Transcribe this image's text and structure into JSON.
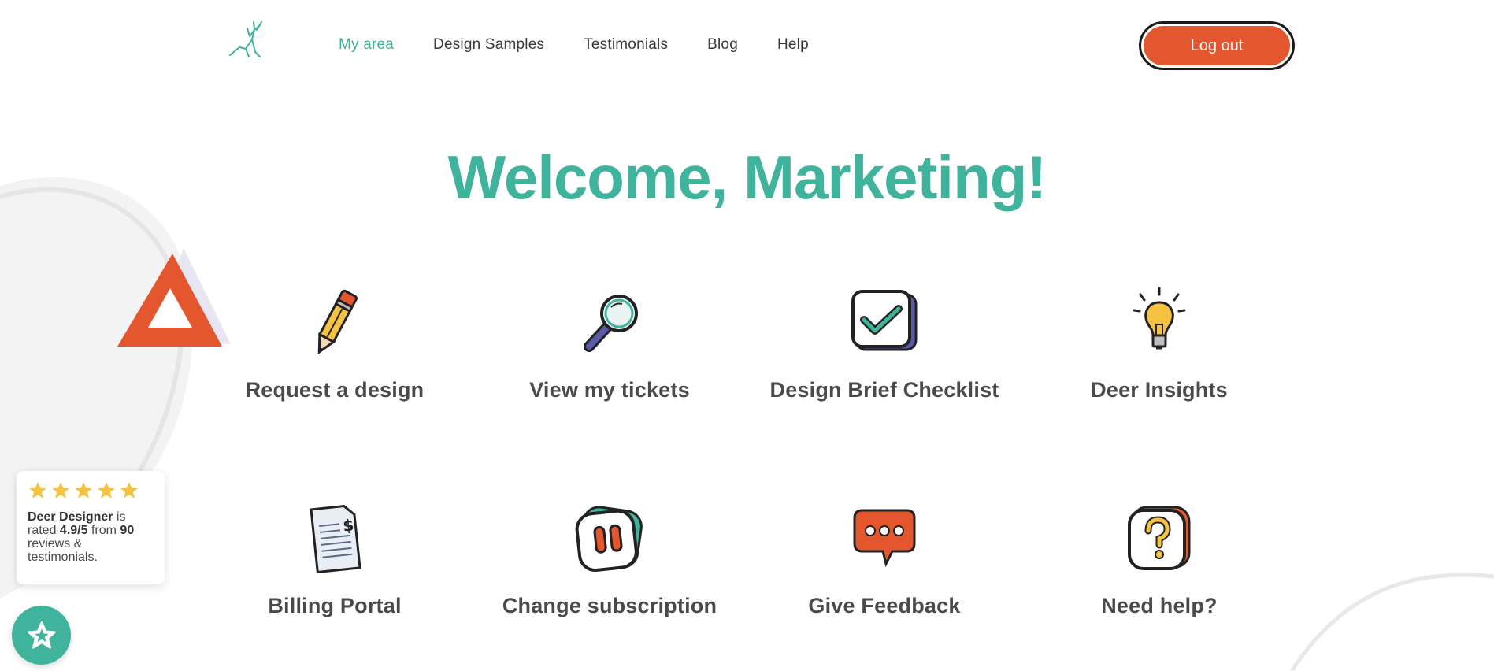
{
  "header": {
    "logo_icon": "deer-antler-icon",
    "nav": [
      {
        "label": "My area",
        "active": true
      },
      {
        "label": "Design Samples",
        "active": false
      },
      {
        "label": "Testimonials",
        "active": false
      },
      {
        "label": "Blog",
        "active": false
      },
      {
        "label": "Help",
        "active": false
      }
    ],
    "logout_label": "Log out"
  },
  "hero": {
    "title": "Welcome, Marketing!"
  },
  "cards": [
    {
      "label": "Request a design",
      "icon": "pencil-icon"
    },
    {
      "label": "View my tickets",
      "icon": "magnifier-icon"
    },
    {
      "label": "Design Brief Checklist",
      "icon": "checkbox-icon"
    },
    {
      "label": "Deer Insights",
      "icon": "lightbulb-icon"
    },
    {
      "label": "Billing Portal",
      "icon": "invoice-icon"
    },
    {
      "label": "Change subscription",
      "icon": "pause-icon"
    },
    {
      "label": "Give Feedback",
      "icon": "speech-bubble-icon"
    },
    {
      "label": "Need help?",
      "icon": "question-icon"
    }
  ],
  "rating_widget": {
    "stars": 5,
    "brand": "Deer Designer",
    "text_is_rated": "is rated",
    "score": "4.9/5",
    "text_from": "from",
    "count": "90",
    "text_tail": "reviews & testimonials."
  },
  "colors": {
    "accent": "#3fb39b",
    "logout": "#e4572e",
    "text": "#4a4a4a",
    "star": "#f5c242"
  }
}
